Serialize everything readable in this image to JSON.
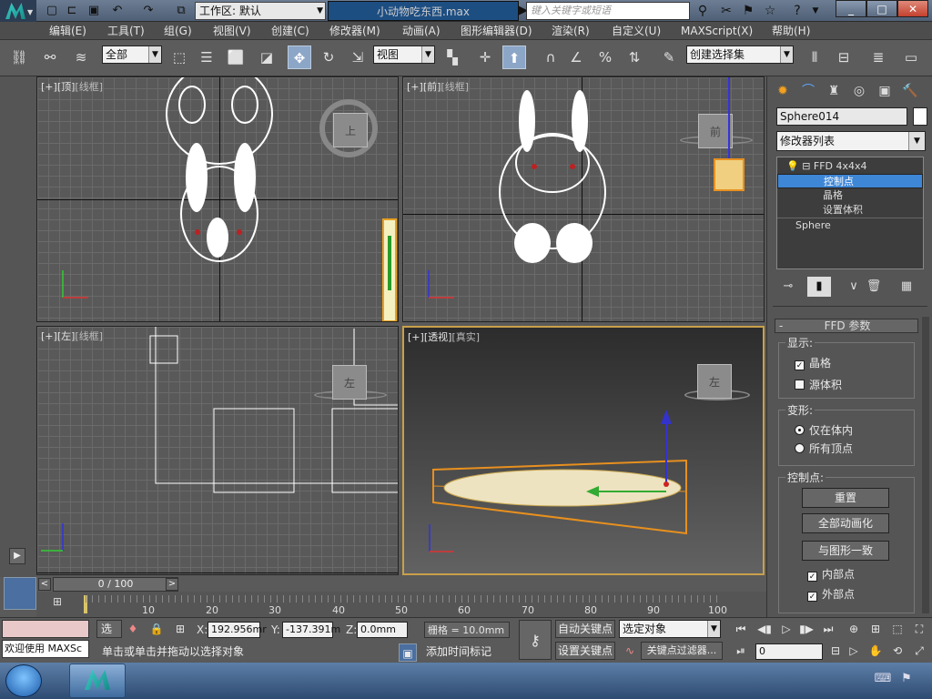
{
  "title_bar": {
    "workspace_label": "工作区: 默认",
    "file_title": "小动物吃东西.max",
    "search_placeholder": "键入关键字或短语"
  },
  "menu": [
    "编辑(E)",
    "工具(T)",
    "组(G)",
    "视图(V)",
    "创建(C)",
    "修改器(M)",
    "动画(A)",
    "图形编辑器(D)",
    "渲染(R)",
    "自定义(U)",
    "MAXScript(X)",
    "帮助(H)"
  ],
  "toolbar": {
    "selection_filter": "全部",
    "reference_coord": "视图",
    "named_selection": "创建选择集"
  },
  "viewports": [
    {
      "id": "top",
      "labels": [
        "[+]",
        "[顶]",
        "[线框]"
      ],
      "cube": "上"
    },
    {
      "id": "front",
      "labels": [
        "[+]",
        "[前]",
        "[线框]"
      ],
      "cube": "前"
    },
    {
      "id": "left",
      "labels": [
        "[+]",
        "[左]",
        "[线框]"
      ],
      "cube": "左"
    },
    {
      "id": "perspective",
      "labels": [
        "[+]",
        "[透视]",
        "[真实]"
      ],
      "cube": "左"
    }
  ],
  "command_panel": {
    "object_name": "Sphere014",
    "modifier_list": "修改器列表",
    "stack": [
      "FFD 4x4x4",
      "控制点",
      "晶格",
      "设置体积",
      "Sphere"
    ],
    "rollout_title": "FFD 参数",
    "display_group": "显示:",
    "lattice": "晶格",
    "source_volume": "源体积",
    "deform_group": "变形:",
    "only_in_volume": "仅在体内",
    "all_vertices": "所有顶点",
    "control_points_group": "控制点:",
    "reset": "重置",
    "animate_all": "全部动画化",
    "conform_to_shape": "与图形一致",
    "inside_points": "内部点",
    "outside_points": "外部点"
  },
  "timeline": {
    "frame_readout": "0 / 100",
    "ticks": [
      "10",
      "20",
      "30",
      "40",
      "50",
      "60",
      "70",
      "80",
      "90",
      "100"
    ]
  },
  "status": {
    "listener_text": "欢迎使用 MAXSc",
    "select_label": "选择",
    "x_value": "192.956mr",
    "y_value": "-137.391m",
    "z_value": "0.0mm",
    "grid_text": "栅格 = 10.0mm",
    "auto_key": "自动关键点",
    "set_key": "设置关键点",
    "key_mode_value": "选定对象",
    "key_filters": "关键点过滤器...",
    "prompt": "单击或单击并拖动以选择对象",
    "add_time_tag": "添加时间标记",
    "frame_value": "0"
  }
}
